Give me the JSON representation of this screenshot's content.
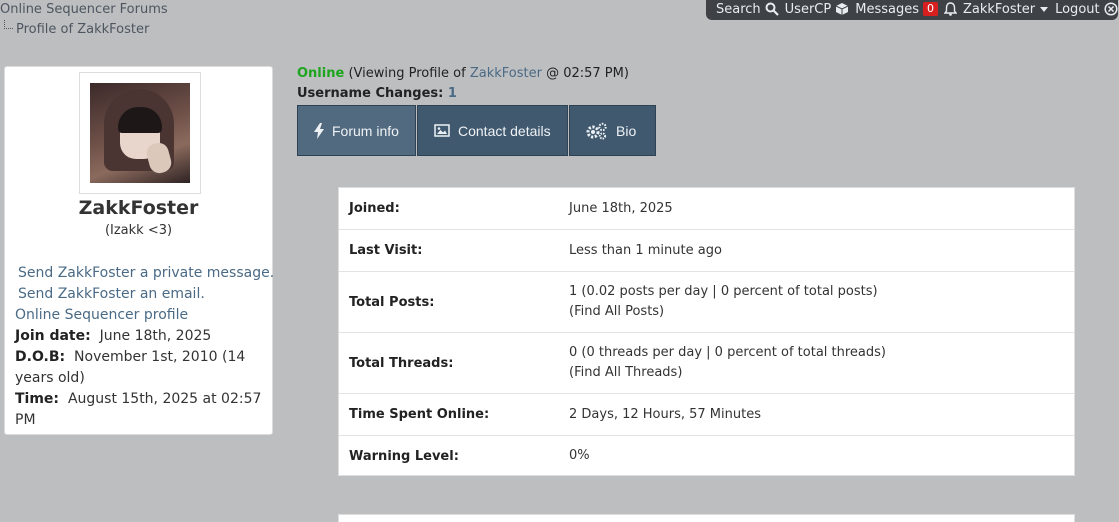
{
  "breadcrumb": {
    "root": "Online Sequencer Forums",
    "current": "Profile of ZakkFoster"
  },
  "topbar": {
    "search": "Search",
    "usercp": "UserCP",
    "messages": "Messages",
    "messages_count": "0",
    "username": "ZakkFoster",
    "logout": "Logout"
  },
  "profile": {
    "username": "ZakkFoster",
    "usertitle": "(Izakk <3)",
    "pm_link": "Send ZakkFoster a private message.",
    "email_link": "Send ZakkFoster an email.",
    "os_profile_link": "Online Sequencer profile",
    "join_label": "Join date:",
    "join_value": "June 18th, 2025",
    "dob_label": "D.O.B:",
    "dob_value": "November 1st, 2010 (14 years old)",
    "time_label": "Time:",
    "time_value": "August 15th, 2025 at 02:57 PM"
  },
  "status": {
    "online": "Online",
    "viewing_prefix": "(Viewing Profile of",
    "viewing_user": "ZakkFoster",
    "viewing_suffix": "@ 02:57 PM)",
    "username_changes_label": "Username Changes:",
    "username_changes_count": "1"
  },
  "tabs": [
    {
      "label": "Forum info",
      "icon": "bolt-icon"
    },
    {
      "label": "Contact details",
      "icon": "image-icon"
    },
    {
      "label": "Bio",
      "icon": "gears-icon"
    }
  ],
  "info": {
    "joined_label": "Joined:",
    "joined_value": "June 18th, 2025",
    "last_visit_label": "Last Visit:",
    "last_visit_value": "Less than 1 minute ago",
    "posts_label": "Total Posts:",
    "posts_value": "1 (0.02 posts per day | 0 percent of total posts)",
    "posts_link": "(Find All Posts)",
    "threads_label": "Total Threads:",
    "threads_value": "0 (0 threads per day | 0 percent of total threads)",
    "threads_link": "(Find All Threads)",
    "online_label": "Time Spent Online:",
    "online_value": "2 Days, 12 Hours, 57 Minutes",
    "warning_label": "Warning Level:",
    "warning_value": "0%"
  },
  "colors": {
    "background": "#bdbec0",
    "link": "#4a6a85",
    "online": "#1ea51e",
    "tab": "#41596f",
    "topbar": "#3e4247",
    "badge": "#d81f1f"
  }
}
